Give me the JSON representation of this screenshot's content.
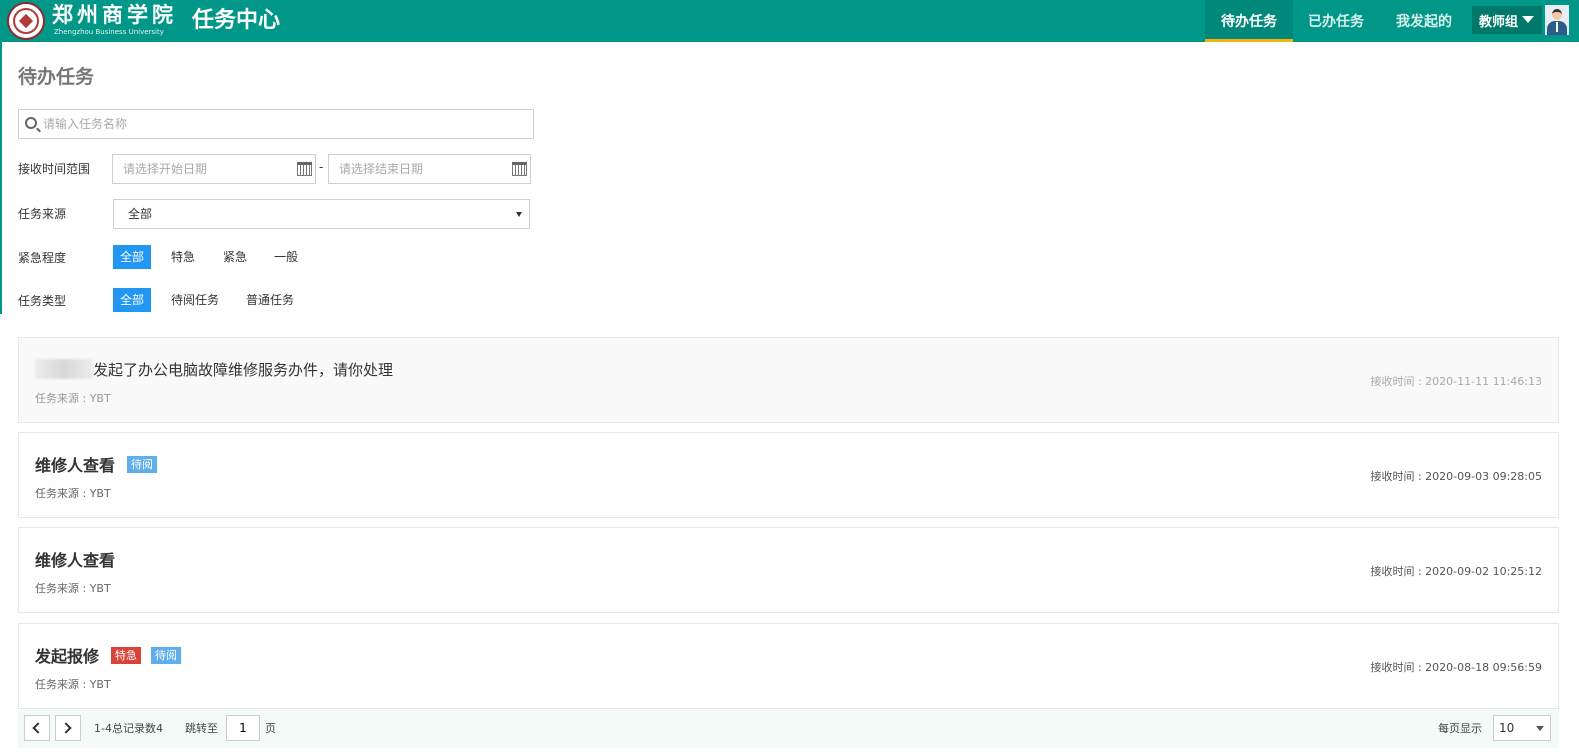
{
  "header": {
    "logo_name": "郑州商学院",
    "logo_en": "Zhengzhou Business University",
    "app_title": "任务中心",
    "nav": [
      {
        "label": "待办任务",
        "active": true
      },
      {
        "label": "已办任务",
        "active": false
      },
      {
        "label": "我发起的",
        "active": false
      }
    ],
    "user_role": "教师组",
    "icons": {
      "dropdown": "caret-down-icon",
      "avatar": "avatar-icon"
    }
  },
  "colors": {
    "header_bg": "#009688",
    "active_underline": "#f5b50a",
    "chip_active": "#2196f3",
    "tag_urgent": "#d9443a",
    "tag_read": "#5fb0ea"
  },
  "page": {
    "title": "待办任务",
    "search_placeholder": "请输入任务名称",
    "date_range_label": "接收时间范围",
    "start_date_placeholder": "请选择开始日期",
    "date_separator": "-",
    "end_date_placeholder": "请选择结束日期",
    "source_label": "任务来源",
    "source_selected": "全部",
    "urgency_label": "紧急程度",
    "urgency_options": [
      "全部",
      "特急",
      "紧急",
      "一般"
    ],
    "urgency_selected": 0,
    "type_label": "任务类型",
    "type_options": [
      "全部",
      "待阅任务",
      "普通任务"
    ],
    "type_selected": 0
  },
  "tasks": [
    {
      "title": "发起了办公电脑故障维修服务办件，请你处理",
      "redacted_prefix": true,
      "tags": [],
      "source": "任务来源 : YBT",
      "time": "接收时间 : 2020-11-11 11:46:13"
    },
    {
      "title": "维修人查看",
      "redacted_prefix": false,
      "tags": [
        {
          "label": "待阅",
          "kind": "read"
        }
      ],
      "source": "任务来源 : YBT",
      "time": "接收时间 : 2020-09-03 09:28:05"
    },
    {
      "title": "维修人查看",
      "redacted_prefix": false,
      "tags": [],
      "source": "任务来源 : YBT",
      "time": "接收时间 : 2020-09-02 10:25:12"
    },
    {
      "title": "发起报修",
      "redacted_prefix": false,
      "tags": [
        {
          "label": "特急",
          "kind": "urgent"
        },
        {
          "label": "待阅",
          "kind": "read"
        }
      ],
      "source": "任务来源 : YBT",
      "time": "接收时间 : 2020-08-18 09:56:59"
    }
  ],
  "pagination": {
    "summary": "1-4总记录数4",
    "jump_label": "跳转至",
    "current_page": "1",
    "page_unit": "页",
    "per_page_label": "每页显示",
    "per_page": "10"
  }
}
